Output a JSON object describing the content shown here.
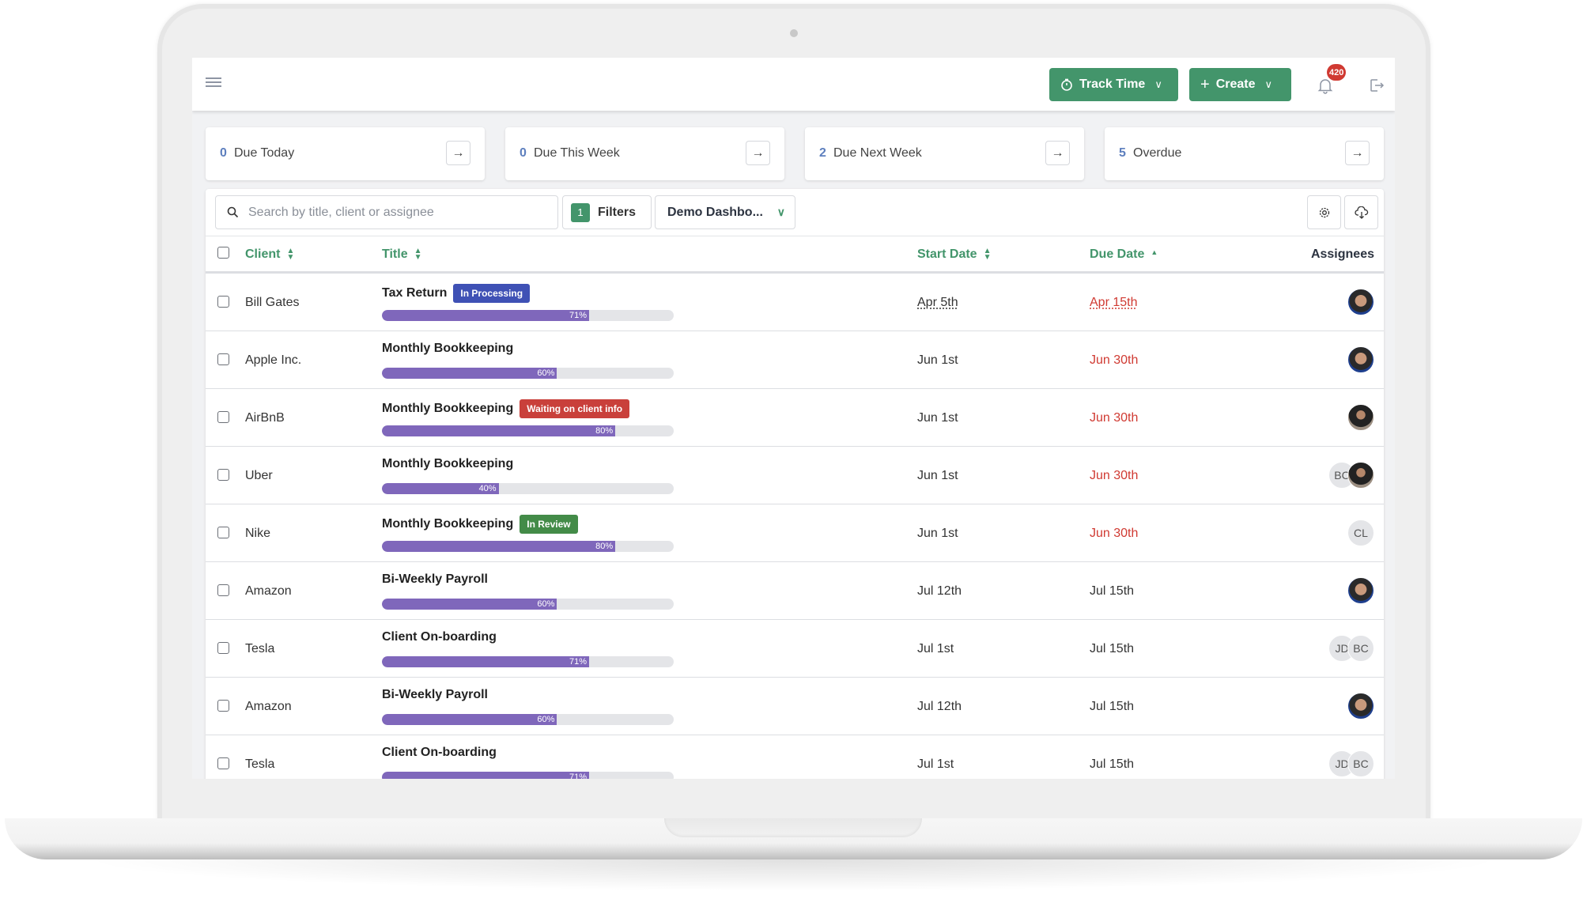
{
  "header": {
    "track_time_label": "Track Time",
    "create_label": "Create",
    "notification_count": "420"
  },
  "summary_cards": [
    {
      "count": "0",
      "label": "Due Today"
    },
    {
      "count": "0",
      "label": "Due This Week"
    },
    {
      "count": "2",
      "label": "Due Next Week"
    },
    {
      "count": "5",
      "label": "Overdue"
    }
  ],
  "toolbar": {
    "search_placeholder": "Search by title, client or assignee",
    "search_value": "",
    "filters_count": "1",
    "filters_label": "Filters",
    "view_selected": "Demo Dashbo..."
  },
  "table": {
    "columns": {
      "client": "Client",
      "title": "Title",
      "start_date": "Start Date",
      "due_date": "Due Date",
      "assignees": "Assignees"
    },
    "sort": {
      "column": "due_date",
      "direction": "ascending"
    },
    "rows": [
      {
        "client": "Bill Gates",
        "title": "Tax Return",
        "tag": "In Processing",
        "tag_color": "#3f51b5",
        "progress": 71,
        "progress_label": "71%",
        "start": "Apr 5th",
        "due": "Apr 15th",
        "due_overdue": true,
        "assignees": [
          {
            "type": "photo",
            "name": "assignee-photo-a"
          }
        ]
      },
      {
        "client": "Apple Inc.",
        "title": "Monthly Bookkeeping",
        "tag": "",
        "tag_color": "",
        "progress": 60,
        "progress_label": "60%",
        "start": "Jun 1st",
        "due": "Jun 30th",
        "due_overdue": true,
        "assignees": [
          {
            "type": "photo",
            "name": "assignee-photo-a"
          }
        ]
      },
      {
        "client": "AirBnB",
        "title": "Monthly Bookkeeping",
        "tag": "Waiting on client info",
        "tag_color": "#c9403b",
        "progress": 80,
        "progress_label": "80%",
        "start": "Jun 1st",
        "due": "Jun 30th",
        "due_overdue": true,
        "assignees": [
          {
            "type": "photo",
            "name": "assignee-photo-b"
          }
        ]
      },
      {
        "client": "Uber",
        "title": "Monthly Bookkeeping",
        "tag": "",
        "tag_color": "",
        "progress": 40,
        "progress_label": "40%",
        "start": "Jun 1st",
        "due": "Jun 30th",
        "due_overdue": true,
        "assignees": [
          {
            "type": "photo",
            "name": "assignee-photo-b"
          },
          {
            "type": "initials",
            "initials": "BC"
          }
        ]
      },
      {
        "client": "Nike",
        "title": "Monthly Bookkeeping",
        "tag": "In Review",
        "tag_color": "#438b48",
        "progress": 80,
        "progress_label": "80%",
        "start": "Jun 1st",
        "due": "Jun 30th",
        "due_overdue": true,
        "assignees": [
          {
            "type": "initials",
            "initials": "CL"
          }
        ]
      },
      {
        "client": "Amazon",
        "title": "Bi-Weekly Payroll",
        "tag": "",
        "tag_color": "",
        "progress": 60,
        "progress_label": "60%",
        "start": "Jul 12th",
        "due": "Jul 15th",
        "due_overdue": false,
        "assignees": [
          {
            "type": "photo",
            "name": "assignee-photo-a"
          }
        ]
      },
      {
        "client": "Tesla",
        "title": "Client On-boarding",
        "tag": "",
        "tag_color": "",
        "progress": 71,
        "progress_label": "71%",
        "start": "Jul 1st",
        "due": "Jul 15th",
        "due_overdue": false,
        "assignees": [
          {
            "type": "initials",
            "initials": "BC"
          },
          {
            "type": "initials",
            "initials": "JD"
          }
        ]
      },
      {
        "client": "Amazon",
        "title": "Bi-Weekly Payroll",
        "tag": "",
        "tag_color": "",
        "progress": 60,
        "progress_label": "60%",
        "start": "Jul 12th",
        "due": "Jul 15th",
        "due_overdue": false,
        "assignees": [
          {
            "type": "photo",
            "name": "assignee-photo-a"
          }
        ]
      },
      {
        "client": "Tesla",
        "title": "Client On-boarding",
        "tag": "",
        "tag_color": "",
        "progress": 71,
        "progress_label": "71%",
        "start": "Jul 1st",
        "due": "Jul 15th",
        "due_overdue": false,
        "assignees": [
          {
            "type": "initials",
            "initials": "BC"
          },
          {
            "type": "initials",
            "initials": "JD"
          }
        ]
      }
    ]
  },
  "colors": {
    "brand_green": "#43956b",
    "progress_purple": "#7f67bb",
    "overdue_red": "#d03a32",
    "count_blue": "#5d7fbe"
  }
}
